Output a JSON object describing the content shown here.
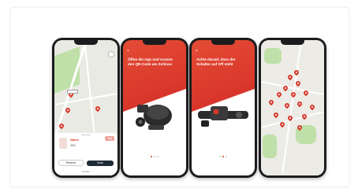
{
  "colors": {
    "brand_red": "#d9382b",
    "map_green": "#bfe0a8",
    "phone_frame": "#1c1c1e"
  },
  "phone1": {
    "scooter_name": "Name",
    "battery_label": "48%",
    "button_left": "Reserve",
    "button_right": "Scan",
    "tag_label": "Tag",
    "footer_link": "Details"
  },
  "phone2": {
    "text": "Öffne die App und scanne den QR-Code am Schloss"
  },
  "phone3": {
    "text": "Achte darauf, dass der Schalter auf Off steht"
  }
}
